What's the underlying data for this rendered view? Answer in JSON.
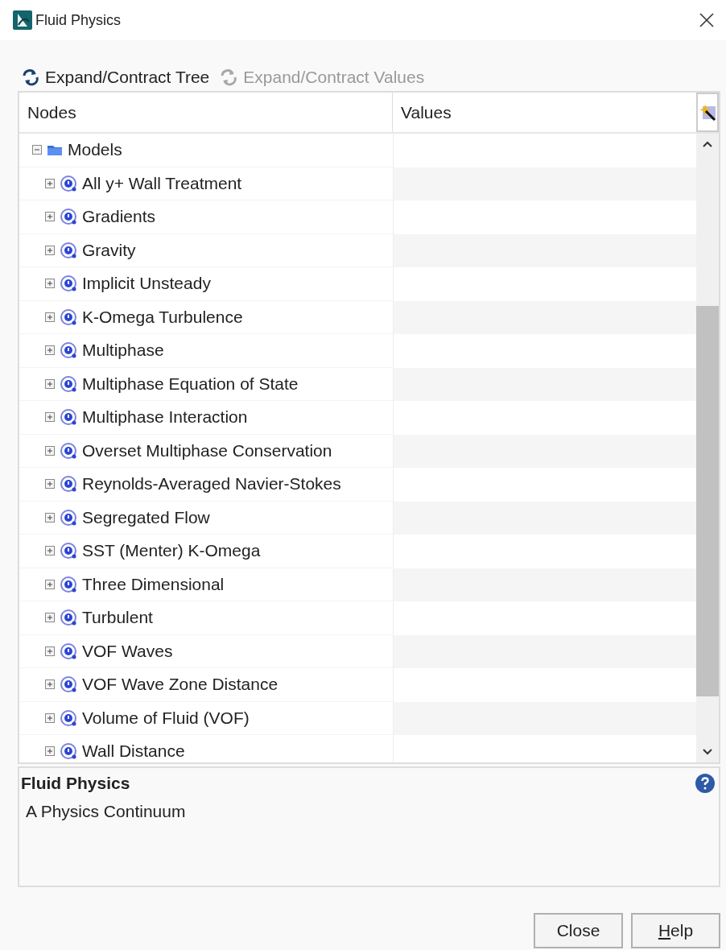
{
  "window": {
    "title": "Fluid Physics"
  },
  "toolbar": [
    {
      "label": "Expand/Contract Tree",
      "disabled": false
    },
    {
      "label": "Expand/Contract Values",
      "disabled": true
    }
  ],
  "tree": {
    "columns": [
      "Nodes",
      "Values"
    ],
    "nodes": [
      {
        "label": "Models",
        "kind": "folder",
        "expanded": true,
        "children": [
          {
            "label": "All y+ Wall Treatment",
            "kind": "model",
            "expanded": false
          },
          {
            "label": "Gradients",
            "kind": "model",
            "expanded": false
          },
          {
            "label": "Gravity",
            "kind": "model",
            "expanded": false
          },
          {
            "label": "Implicit Unsteady",
            "kind": "model",
            "expanded": false
          },
          {
            "label": "K-Omega Turbulence",
            "kind": "model",
            "expanded": false
          },
          {
            "label": "Multiphase",
            "kind": "model",
            "expanded": false
          },
          {
            "label": "Multiphase Equation of State",
            "kind": "model",
            "expanded": false
          },
          {
            "label": "Multiphase Interaction",
            "kind": "model",
            "expanded": false
          },
          {
            "label": "Overset Multiphase Conservation",
            "kind": "model",
            "expanded": false
          },
          {
            "label": "Reynolds-Averaged Navier-Stokes",
            "kind": "model",
            "expanded": false
          },
          {
            "label": "Segregated Flow",
            "kind": "model",
            "expanded": false
          },
          {
            "label": "SST (Menter) K-Omega",
            "kind": "model",
            "expanded": false
          },
          {
            "label": "Three Dimensional",
            "kind": "model",
            "expanded": false
          },
          {
            "label": "Turbulent",
            "kind": "model",
            "expanded": false
          },
          {
            "label": "VOF Waves",
            "kind": "model",
            "expanded": false
          },
          {
            "label": "VOF Wave Zone Distance",
            "kind": "model",
            "expanded": false
          },
          {
            "label": "Volume of Fluid (VOF)",
            "kind": "model",
            "expanded": false
          },
          {
            "label": "Wall Distance",
            "kind": "model",
            "expanded": false
          }
        ]
      }
    ]
  },
  "description": {
    "title": "Fluid Physics",
    "text": "A Physics Continuum"
  },
  "buttons": [
    {
      "label": "Close",
      "mnemonic": false
    },
    {
      "label": "Help",
      "mnemonic": true
    }
  ]
}
